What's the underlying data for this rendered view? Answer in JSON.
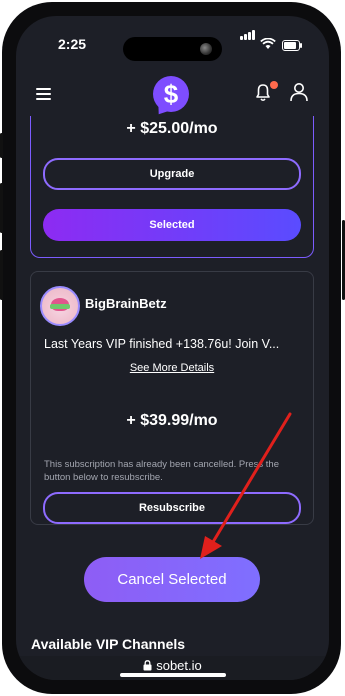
{
  "status": {
    "time": "2:25",
    "battery_percent": 85
  },
  "header": {
    "logo_symbol": "$",
    "menu_icon": "hamburger-icon",
    "bell_icon": "bell-icon",
    "user_icon": "user-icon",
    "accent": "#7e4dff"
  },
  "plan1": {
    "price": "+ $25.00/mo",
    "upgrade_label": "Upgrade",
    "selected_label": "Selected"
  },
  "plan2": {
    "name": "BigBrainBetz",
    "description": "Last Years VIP finished +138.76u! Join V...",
    "see_more": "See More Details",
    "price": "+ $39.99/mo",
    "cancel_note": "This subscription has already been cancelled. Press the button below to resubscribe.",
    "resubscribe_label": "Resubscribe"
  },
  "cancel_button": "Cancel Selected",
  "section_title": "Available VIP Channels",
  "footer": {
    "site": "sobet.io",
    "lock_icon": "lock-icon"
  },
  "annotation": {
    "arrow_color": "#e0201c"
  }
}
